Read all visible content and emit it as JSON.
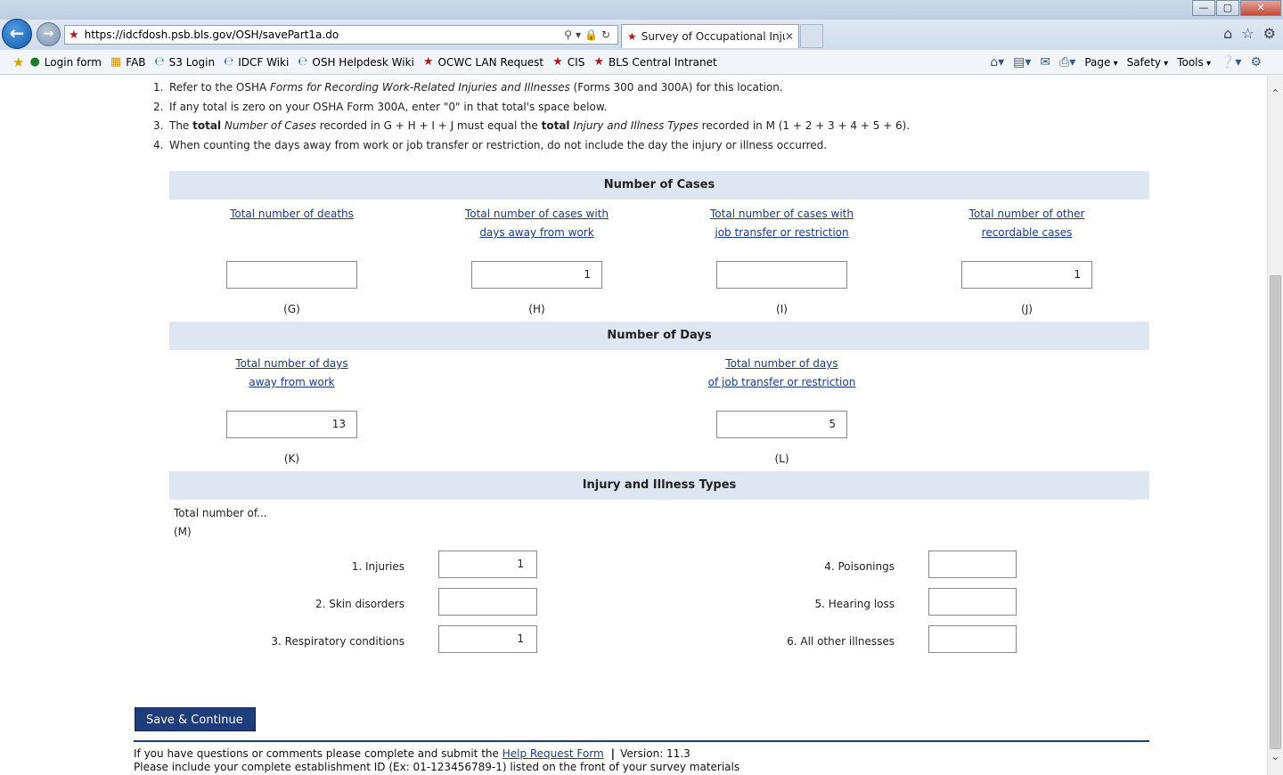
{
  "browser": {
    "window_controls": [
      "—",
      "▢",
      "✕"
    ],
    "address_url": "https://idcfdosh.psb.bls.gov/OSH/savePart1a.do",
    "tab_title": "Survey of Occupational Inju...",
    "favorites": [
      {
        "label": "Login form",
        "icon": "globe-icon"
      },
      {
        "label": "FAB",
        "icon": "grid-icon"
      },
      {
        "label": "S3 Login",
        "icon": "ie-icon"
      },
      {
        "label": "IDCF Wiki",
        "icon": "ie-icon"
      },
      {
        "label": "OSH Helpdesk Wiki",
        "icon": "ie-icon"
      },
      {
        "label": "OCWC LAN Request",
        "icon": "redstar-icon"
      },
      {
        "label": "CIS",
        "icon": "redstar-icon"
      },
      {
        "label": "BLS Central Intranet",
        "icon": "redstar-icon"
      }
    ],
    "command_menus": {
      "page": "Page",
      "safety": "Safety",
      "tools": "Tools"
    }
  },
  "instructions": [
    {
      "num": "1.",
      "parts": [
        "Refer to the OSHA ",
        "Forms for Recording Work-Related Injuries and Illnesses",
        " (Forms 300 and 300A) for this location."
      ]
    },
    {
      "num": "2.",
      "text": "If any total is zero on your OSHA Form 300A, enter \"0\" in that total's space below."
    },
    {
      "num": "3.",
      "parts": [
        "The ",
        "total",
        " ",
        "Number of Cases",
        " recorded in G + H + I + J must equal the ",
        "total",
        " ",
        "Injury and Illness Types",
        " recorded in M (1 + 2 + 3 + 4 + 5 + 6)."
      ]
    },
    {
      "num": "4.",
      "text": "When counting the days away from work or job transfer or restriction, do not include the day the injury or illness occurred."
    }
  ],
  "cases": {
    "heading": "Number of Cases",
    "items": [
      {
        "line1": "Total number of deaths",
        "line2": "",
        "value": "",
        "letter": "(G)"
      },
      {
        "line1": "Total number of cases with",
        "line2": "days away from work",
        "value": "1",
        "letter": "(H)"
      },
      {
        "line1": "Total number of cases with",
        "line2": "job transfer or restriction",
        "value": "",
        "letter": "(I)"
      },
      {
        "line1": "Total number of other",
        "line2": "recordable cases",
        "value": "1",
        "letter": "(J)"
      }
    ]
  },
  "days": {
    "heading": "Number of Days",
    "items": [
      {
        "line1": "Total number of days",
        "line2": "away from work",
        "value": "13",
        "letter": "(K)"
      },
      {
        "line1": "Total number of days",
        "line2": "of job transfer or restriction",
        "value": "5",
        "letter": "(L)"
      }
    ]
  },
  "types": {
    "heading": "Injury and Illness Types",
    "total_label": "Total number of...",
    "m_label": "(M)",
    "items": [
      {
        "label": "1. Injuries",
        "value": "1"
      },
      {
        "label": "2. Skin disorders",
        "value": ""
      },
      {
        "label": "3. Respiratory conditions",
        "value": "1"
      },
      {
        "label": "4. Poisonings",
        "value": ""
      },
      {
        "label": "5. Hearing loss",
        "value": ""
      },
      {
        "label": "6. All other illnesses",
        "value": ""
      }
    ]
  },
  "save_button": "Save & Continue",
  "footer": {
    "line1_prefix": "If you have questions or comments please complete and submit the ",
    "help_link": "Help Request Form",
    "separator": "|",
    "version": "Version: 11.3",
    "line2": "Please include your complete establishment ID (Ex: 01-123456789-1) listed on the front of your survey materials"
  }
}
